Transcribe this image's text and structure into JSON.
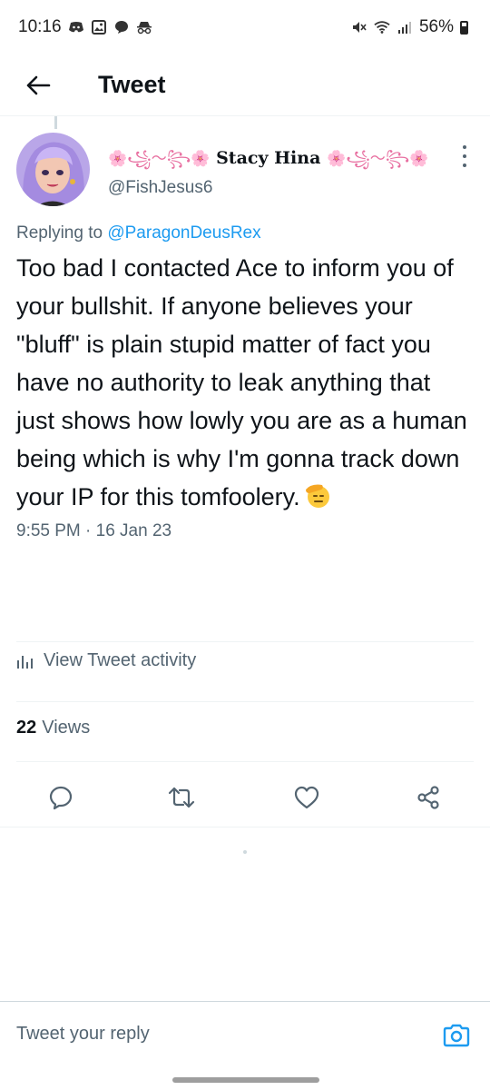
{
  "status_bar": {
    "time": "10:16",
    "battery": "56%",
    "left_icons": [
      "discord-icon",
      "gallery-icon",
      "chat-bubble-icon",
      "incognito-icon"
    ],
    "right_icons": [
      "mute-icon",
      "wifi-icon",
      "signal-icon",
      "battery-icon"
    ]
  },
  "header": {
    "title": "Tweet",
    "back_icon": "arrow-left-icon"
  },
  "tweet": {
    "display_name_prefix": "🌸꧁〜꧂🌸",
    "display_name": "Stacy Hina",
    "display_name_suffix": "🌸꧁〜꧂🌸",
    "handle": "@FishJesus6",
    "replying_to_label": "Replying to",
    "replying_to_handle": "@ParagonDeusRex",
    "text": "Too bad I contacted Ace to inform you of your bullshit. If anyone believes your \"bluff\" is plain stupid matter of fact you have no authority to leak anything that just shows how lowly you are as a human being which is why I'm gonna track down your IP for this tomfoolery.",
    "emoji": "saluting-face-icon",
    "timestamp": "9:55 PM · 16 Jan 23",
    "view_activity_label": "View Tweet activity",
    "views_count": "22",
    "views_label": "Views"
  },
  "actions": [
    {
      "name": "reply-icon"
    },
    {
      "name": "retweet-icon"
    },
    {
      "name": "like-icon"
    },
    {
      "name": "share-icon"
    }
  ],
  "reply_bar": {
    "placeholder": "Tweet your reply",
    "camera_icon": "camera-icon"
  },
  "colors": {
    "accent": "#1d9bf0",
    "text_primary": "#0f1419",
    "text_secondary": "#536471",
    "divider": "#eff3f4"
  }
}
